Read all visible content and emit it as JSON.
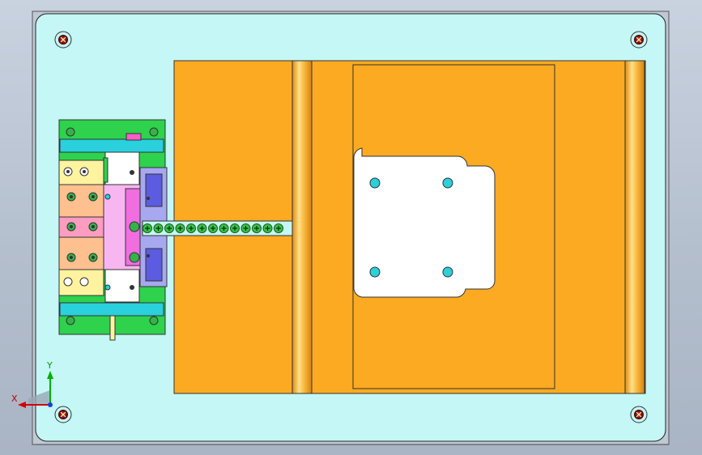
{
  "viewport": {
    "background": "#b9c3d1",
    "plate_color": "#c4f7f5",
    "mold_color": "#fbaa22",
    "guide_rail_color": "#f5b942",
    "screw_strip_color": "#39c249",
    "left_block_color": "#2ed24c"
  },
  "triad": {
    "x_label": "X",
    "y_label": "Y",
    "x_color": "#d40000",
    "y_color": "#00b000",
    "z_color": "#1c3fd8"
  },
  "icons": [
    "bolt-icon",
    "coordinate-triad-icon",
    "screw-icon"
  ]
}
